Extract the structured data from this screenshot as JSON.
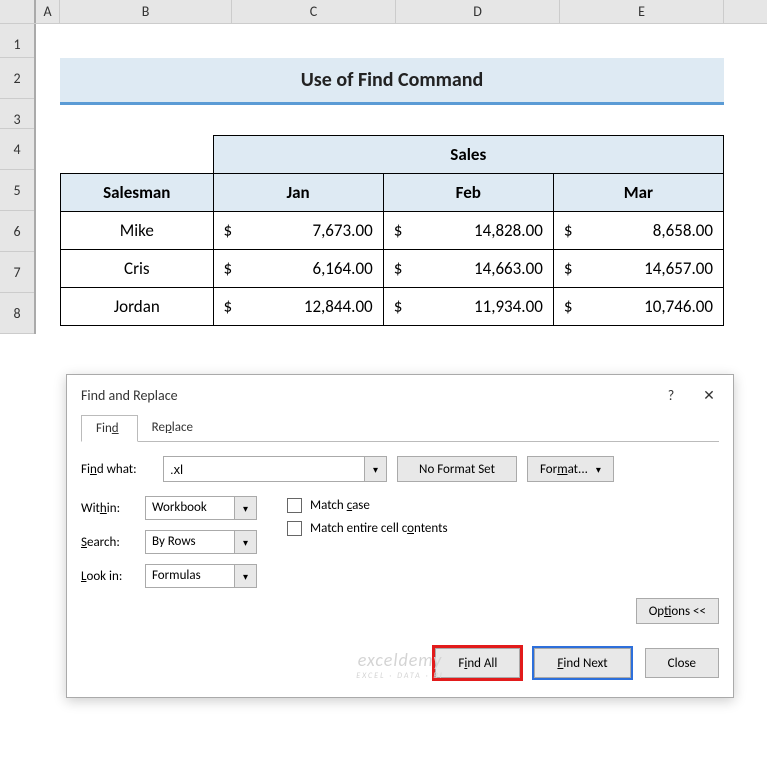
{
  "columns": [
    "A",
    "B",
    "C",
    "D",
    "E"
  ],
  "rows": [
    "1",
    "2",
    "3",
    "4",
    "5",
    "6",
    "7",
    "8"
  ],
  "title": "Use of Find Command",
  "table": {
    "salesHeader": "Sales",
    "salesmanHeader": "Salesman",
    "months": [
      "Jan",
      "Feb",
      "Mar"
    ],
    "data": [
      {
        "name": "Mike",
        "jan": "7,673.00",
        "feb": "14,828.00",
        "mar": "8,658.00"
      },
      {
        "name": "Cris",
        "jan": "6,164.00",
        "feb": "14,663.00",
        "mar": "14,657.00"
      },
      {
        "name": "Jordan",
        "jan": "12,844.00",
        "feb": "11,934.00",
        "mar": "10,746.00"
      }
    ],
    "currency": "$"
  },
  "dialog": {
    "title": "Find and Replace",
    "tabs": {
      "find": "Find",
      "replace": "Replace"
    },
    "findWhatLabel": "Find what:",
    "findWhatValue": ".xl",
    "noFormat": "No Format Set",
    "formatBtn": "Format...",
    "withinLabel": "Within:",
    "withinValue": "Workbook",
    "searchLabel": "Search:",
    "searchValue": "By Rows",
    "lookInLabel": "Look in:",
    "lookInValue": "Formulas",
    "matchCase": "Match case",
    "matchEntire": "Match entire cell contents",
    "optionsBtn": "Options <<",
    "findAll": "Find All",
    "findNext": "Find Next",
    "close": "Close"
  },
  "watermark": {
    "main": "exceldemy",
    "sub": "EXCEL · DATA · BI"
  }
}
